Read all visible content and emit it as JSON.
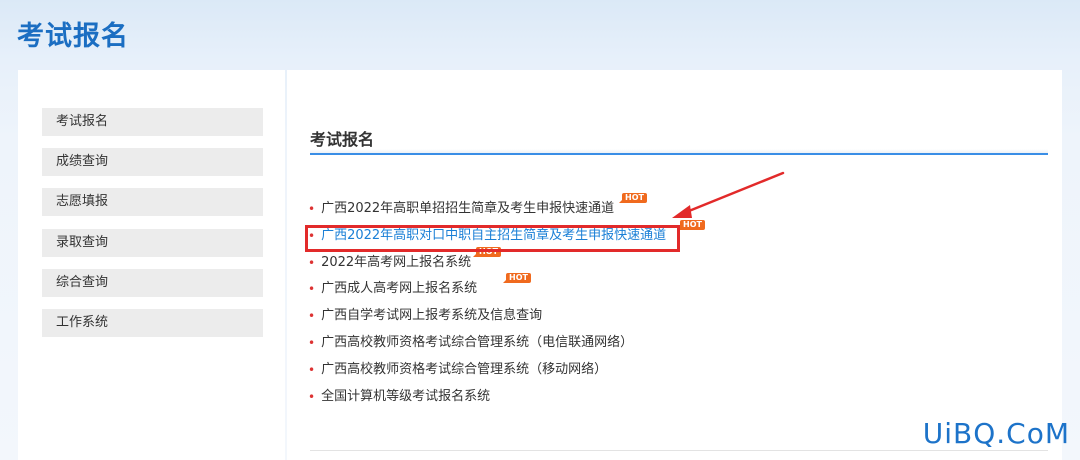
{
  "header": {
    "title": "考试报名"
  },
  "sidebar": {
    "items": [
      {
        "label": "考试报名"
      },
      {
        "label": "成绩查询"
      },
      {
        "label": "志愿填报"
      },
      {
        "label": "录取查询"
      },
      {
        "label": "综合查询"
      },
      {
        "label": "工作系统"
      }
    ]
  },
  "main": {
    "section_title": "考试报名",
    "links": [
      {
        "text": "广西2022年高职单招招生简章及考生申报快速通道",
        "hot": "HOT"
      },
      {
        "text": "广西2022年高职对口中职自主招生简章及考生申报快速通道",
        "hot": "HOT"
      },
      {
        "text": "2022年高考网上报名系统",
        "hot": "HOT"
      },
      {
        "text": "广西成人高考网上报名系统",
        "hot": "HOT"
      },
      {
        "text": "广西自学考试网上报考系统及信息查询"
      },
      {
        "text": "广西高校教师资格考试综合管理系统（电信联通网络）"
      },
      {
        "text": "广西高校教师资格考试综合管理系统（移动网络）"
      },
      {
        "text": "全国计算机等级考试报名系统"
      }
    ]
  },
  "watermark": "UiBQ.CoM",
  "colors": {
    "header_blue": "#1b6ec2",
    "link_active": "#1a7fd6",
    "highlight_red": "#e22a2a",
    "hot_orange": "#f06a1e"
  }
}
